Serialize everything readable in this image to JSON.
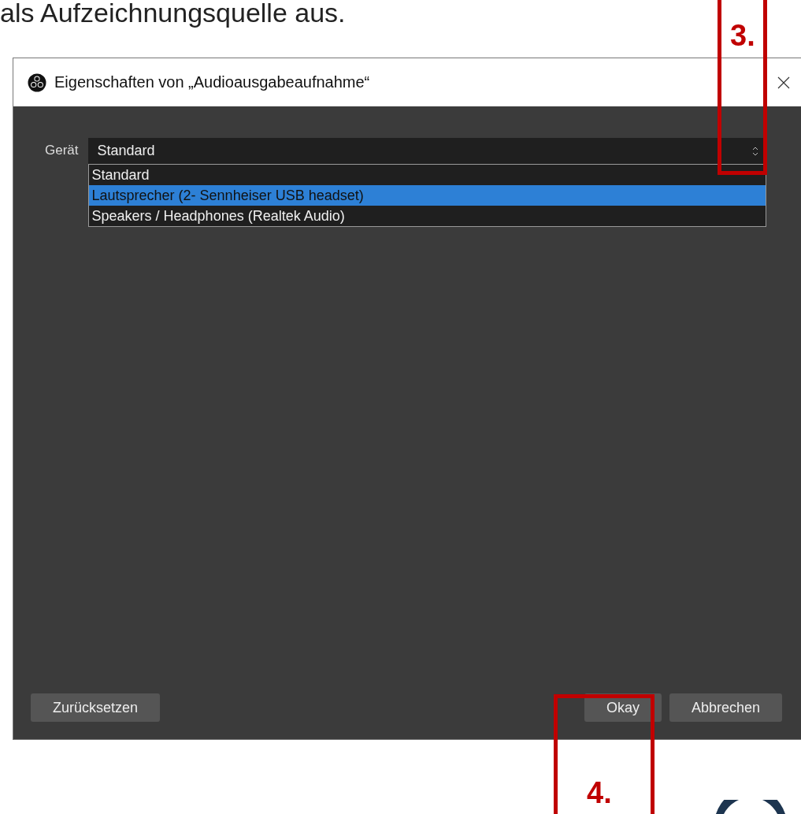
{
  "caption": "als Aufzeichnungsquelle aus.",
  "dialog": {
    "title": "Eigenschaften von „Audioausgabeaufnahme“",
    "field_label": "Gerät",
    "combo_value": "Standard",
    "options": [
      {
        "label": "Standard",
        "selected": false
      },
      {
        "label": "Lautsprecher (2- Sennheiser USB headset)",
        "selected": true
      },
      {
        "label": "Speakers / Headphones (Realtek Audio)",
        "selected": false
      }
    ],
    "buttons": {
      "reset": "Zurücksetzen",
      "ok": "Okay",
      "cancel": "Abbrechen"
    }
  },
  "annotations": [
    {
      "label": "3."
    },
    {
      "label": "4."
    }
  ]
}
